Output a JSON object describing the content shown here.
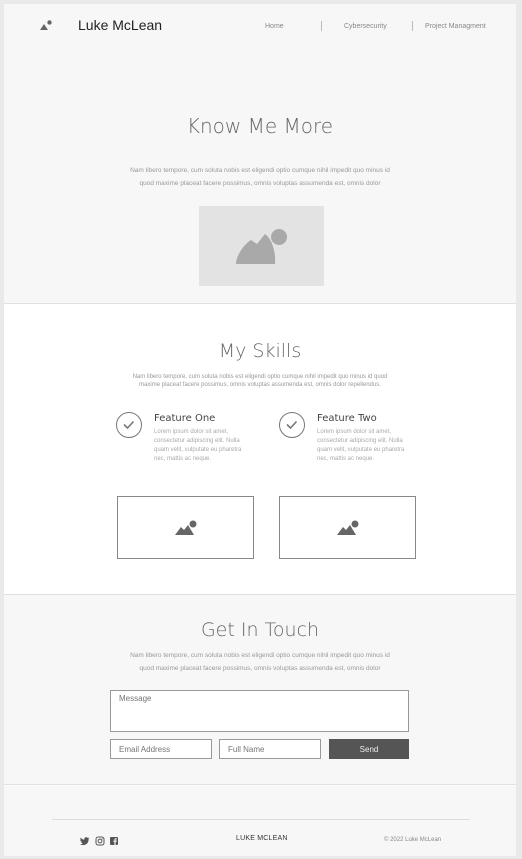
{
  "header": {
    "brand": "Luke McLean",
    "nav": [
      "Home",
      "Cybersecurity",
      "Project Managment"
    ]
  },
  "hero": {
    "title": "Know Me More",
    "text": "Nam libero tempore, cum soluta nobis est eligendi optio cumque nihil impedit quo minus id\nquod maxime placeat facere possimus, omnis voluptas assumenda est, omnis dolor"
  },
  "skills": {
    "title": "My Skills",
    "text": "Nam libero tempore, cum soluta nobis est eligendi optio cumque nihil impedit quo minus id quod\nmaxime placeat facere possimus, omnis voluptas assumenda est, omnis dolor repellendus.",
    "features": [
      {
        "title": "Feature One",
        "text": "Lorem ipsum dolor sit amet,\nconsectetur adipiscing elit. Nulla\nquam velit, vulputate eu pharetra\nnec, mattis ac neque."
      },
      {
        "title": "Feature Two",
        "text": "Lorem ipsum dolor sit amet,\nconsectetur adipiscing elit. Nulla\nquam velit, vulputate eu pharetra\nnec, mattis ac neque."
      }
    ]
  },
  "contact": {
    "title": "Get In Touch",
    "text": "Nam libero tempore, cum soluta nobis est eligendi optio cumque nihil impedit quo minus id\nquod maxime placeat facere possimus, omnis voluptas assumenda est, omnis dolor",
    "message_placeholder": "Message",
    "email_placeholder": "Email Address",
    "name_placeholder": "Full Name",
    "send_label": "Send"
  },
  "footer": {
    "brand": "LUKE MCLEAN",
    "copyright": "© 2022 Luke McLean",
    "social_icons": [
      "twitter-icon",
      "instagram-icon",
      "facebook-icon"
    ]
  },
  "colors": {
    "section_bg": "#f7f7f7",
    "placeholder_bg": "#e3e3e3",
    "icon": "#777777",
    "button_bg": "#555555"
  }
}
